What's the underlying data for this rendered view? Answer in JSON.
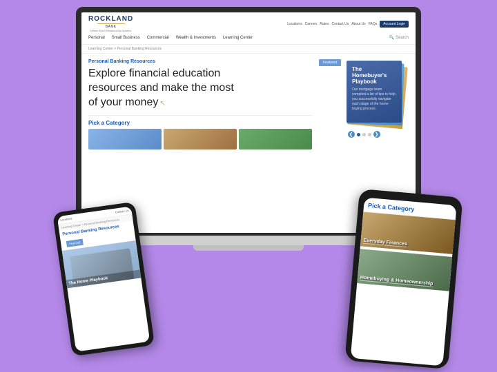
{
  "page": {
    "background_color": "#b388e8"
  },
  "laptop": {
    "header": {
      "logo_name": "ROCKLAND",
      "logo_sub": "BANK",
      "logo_tagline": "Where Each Relationship Matters",
      "top_links": [
        "Locations",
        "Careers",
        "Rates",
        "Contact Us",
        "About Us",
        "FAQs"
      ],
      "account_login": "Account Login",
      "nav_items": [
        "Personal",
        "Small Business",
        "Commercial",
        "Wealth & Investments",
        "Learning Center"
      ],
      "search_label": "Search",
      "breadcrumb": "Learning Center > Personal Banking Resources"
    },
    "main": {
      "section_title": "Personal Banking Resources",
      "hero_text_line1": "Explore financial education",
      "hero_text_line2": "resources and make the most",
      "hero_text_line3": "of your money",
      "featured_tag": "Featured",
      "featured_title": "The Homebuyer's Playbook",
      "featured_desc": "Our mortgage team compiled a list of tips to help you successfully navigate each stage of the home-buying process.",
      "pick_category_title": "Pick a Category"
    }
  },
  "phone_left": {
    "breadcrumb": "Learning Center > Personal Banking Resources",
    "section_title": "Personal Banking Resources",
    "featured_tag": "Featured",
    "featured_image_alt": "homebuyer image",
    "featured_title": "The Home Playbook"
  },
  "phone_right": {
    "pick_category_title": "Pick a Category",
    "categories": [
      {
        "label": "Everyday Finances"
      },
      {
        "label": "Homebuying & Homeownership"
      }
    ]
  },
  "icons": {
    "search": "🔍",
    "arrow_left": "❮",
    "arrow_right": "❯",
    "cursor": "↖"
  }
}
